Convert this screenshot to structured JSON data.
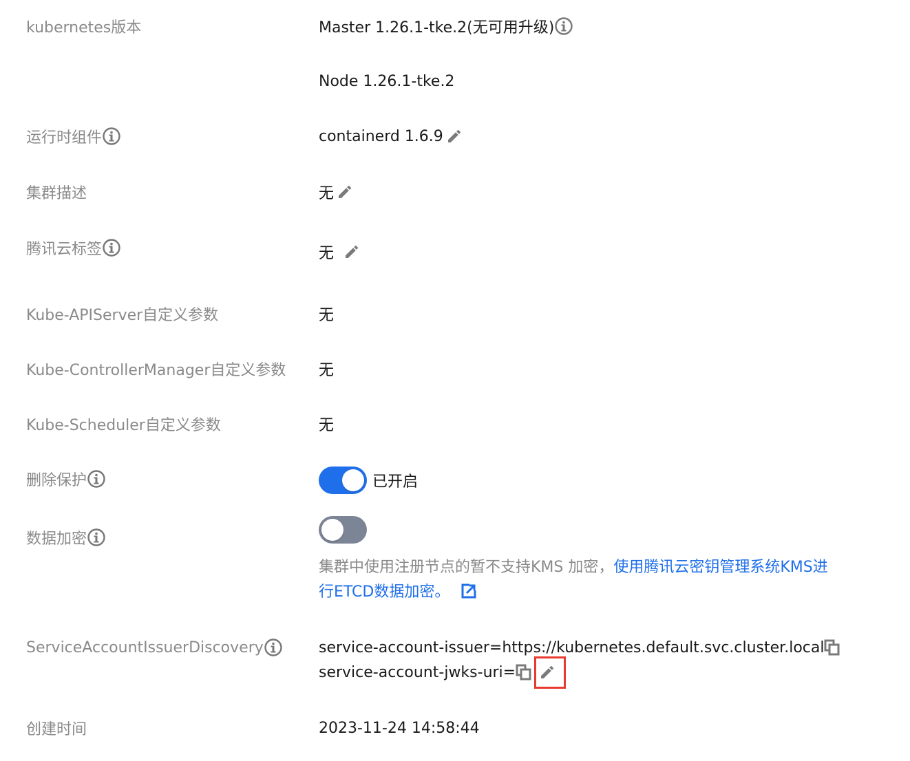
{
  "colors": {
    "label": "#8a8a8a",
    "value": "#1a1a1a",
    "link": "#1f6fea",
    "toggle_on": "#1f6fea",
    "toggle_off": "#7c8596",
    "highlight": "#e83a2f"
  },
  "k8s_version": {
    "label": "kubernetes版本",
    "master": "Master 1.26.1-tke.2(无可用升级)",
    "node": "Node 1.26.1-tke.2"
  },
  "runtime": {
    "label": "运行时组件",
    "value": "containerd 1.6.9"
  },
  "cluster_desc": {
    "label": "集群描述",
    "value": "无"
  },
  "tags": {
    "label": "腾讯云标签",
    "value": "无"
  },
  "apiserver_params": {
    "label": "Kube-APIServer自定义参数",
    "value": "无"
  },
  "controller_params": {
    "label": "Kube-ControllerManager自定义参数",
    "value": "无"
  },
  "scheduler_params": {
    "label": "Kube-Scheduler自定义参数",
    "value": "无"
  },
  "deletion_protection": {
    "label": "删除保护",
    "enabled": true,
    "status_text": "已开启"
  },
  "data_encryption": {
    "label": "数据加密",
    "enabled": false,
    "note_text": "集群中使用注册节点的暂不支持KMS 加密，",
    "link_text": "使用腾讯云密钥管理系统KMS进行ETCD数据加密。"
  },
  "sa_issuer": {
    "label": "ServiceAccountIssuerDiscovery",
    "issuer": "service-account-issuer=https://kubernetes.default.svc.cluster.local",
    "jwks": "service-account-jwks-uri="
  },
  "created": {
    "label": "创建时间",
    "value": "2023-11-24 14:58:44"
  }
}
